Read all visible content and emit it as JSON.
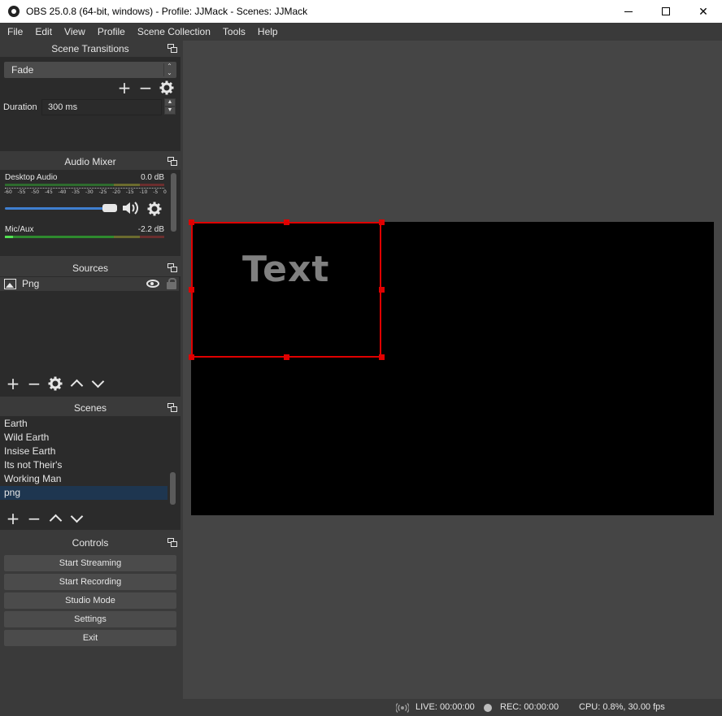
{
  "window": {
    "title": "OBS 25.0.8 (64-bit, windows) - Profile: JJMack - Scenes: JJMack",
    "minimize_glyph": "—",
    "close_glyph": "✕"
  },
  "menu": [
    "File",
    "Edit",
    "View",
    "Profile",
    "Scene Collection",
    "Tools",
    "Help"
  ],
  "transitions": {
    "title": "Scene Transitions",
    "selected": "Fade",
    "add": "+",
    "remove": "−",
    "duration_label": "Duration",
    "duration_value": "300 ms"
  },
  "mixer": {
    "title": "Audio Mixer",
    "ticks": [
      "-60",
      "-55",
      "-50",
      "-45",
      "-40",
      "-35",
      "-30",
      "-25",
      "-20",
      "-15",
      "-10",
      "-5",
      "0"
    ],
    "channels": [
      {
        "name": "Desktop Audio",
        "db": "0.0 dB",
        "level": 0
      },
      {
        "name": "Mic/Aux",
        "db": "-2.2 dB",
        "level": 0.05
      }
    ]
  },
  "sources": {
    "title": "Sources",
    "items": [
      {
        "name": "Png"
      }
    ],
    "add": "+",
    "remove": "−"
  },
  "scenes": {
    "title": "Scenes",
    "items": [
      "Earth",
      "Wild Earth",
      "Insise Earth",
      "Its not Their's",
      "Working Man",
      "png"
    ],
    "selected_index": 5,
    "add": "+",
    "remove": "−"
  },
  "controls": {
    "title": "Controls",
    "start_streaming": "Start Streaming",
    "start_recording": "Start Recording",
    "studio_mode": "Studio Mode",
    "settings": "Settings",
    "exit": "Exit"
  },
  "preview": {
    "text": "Text"
  },
  "status": {
    "live": "LIVE: 00:00:00",
    "rec": "REC: 00:00:00",
    "cpu": "CPU: 0.8%, 30.00 fps"
  },
  "colors": {
    "selection": "#e00000",
    "accent": "#3f7fd0",
    "scene_selected": "#1e3650"
  }
}
